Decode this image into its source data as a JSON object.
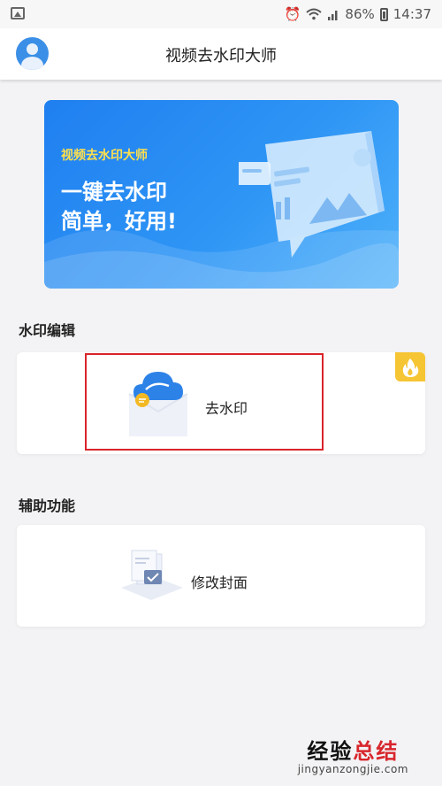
{
  "status_bar": {
    "battery": "86%",
    "time": "14:37",
    "icons": [
      "gallery-icon",
      "alarm-icon",
      "wifi-icon",
      "signal-icon",
      "battery-icon"
    ]
  },
  "header": {
    "title": "视频去水印大师",
    "avatar_icon": "user-avatar-icon"
  },
  "banner": {
    "tag": "视频去水印大师",
    "line1": "一键去水印",
    "line2": "简单，好用!"
  },
  "sections": {
    "watermark_edit": {
      "title": "水印编辑",
      "card_label": "去水印",
      "card_icon": "cloud-icon",
      "badge_icon": "fire-icon"
    },
    "assist": {
      "title": "辅助功能",
      "card_label": "修改封面",
      "card_icon": "document-icon"
    }
  },
  "watermark_logo": {
    "part1": "经验",
    "part2": "总结",
    "url": "jingyanzongjie.com"
  },
  "colors": {
    "accent": "#2e8df0",
    "highlight": "#d9242a",
    "badge": "#f6c534",
    "banner_tag": "#ffe04d"
  }
}
